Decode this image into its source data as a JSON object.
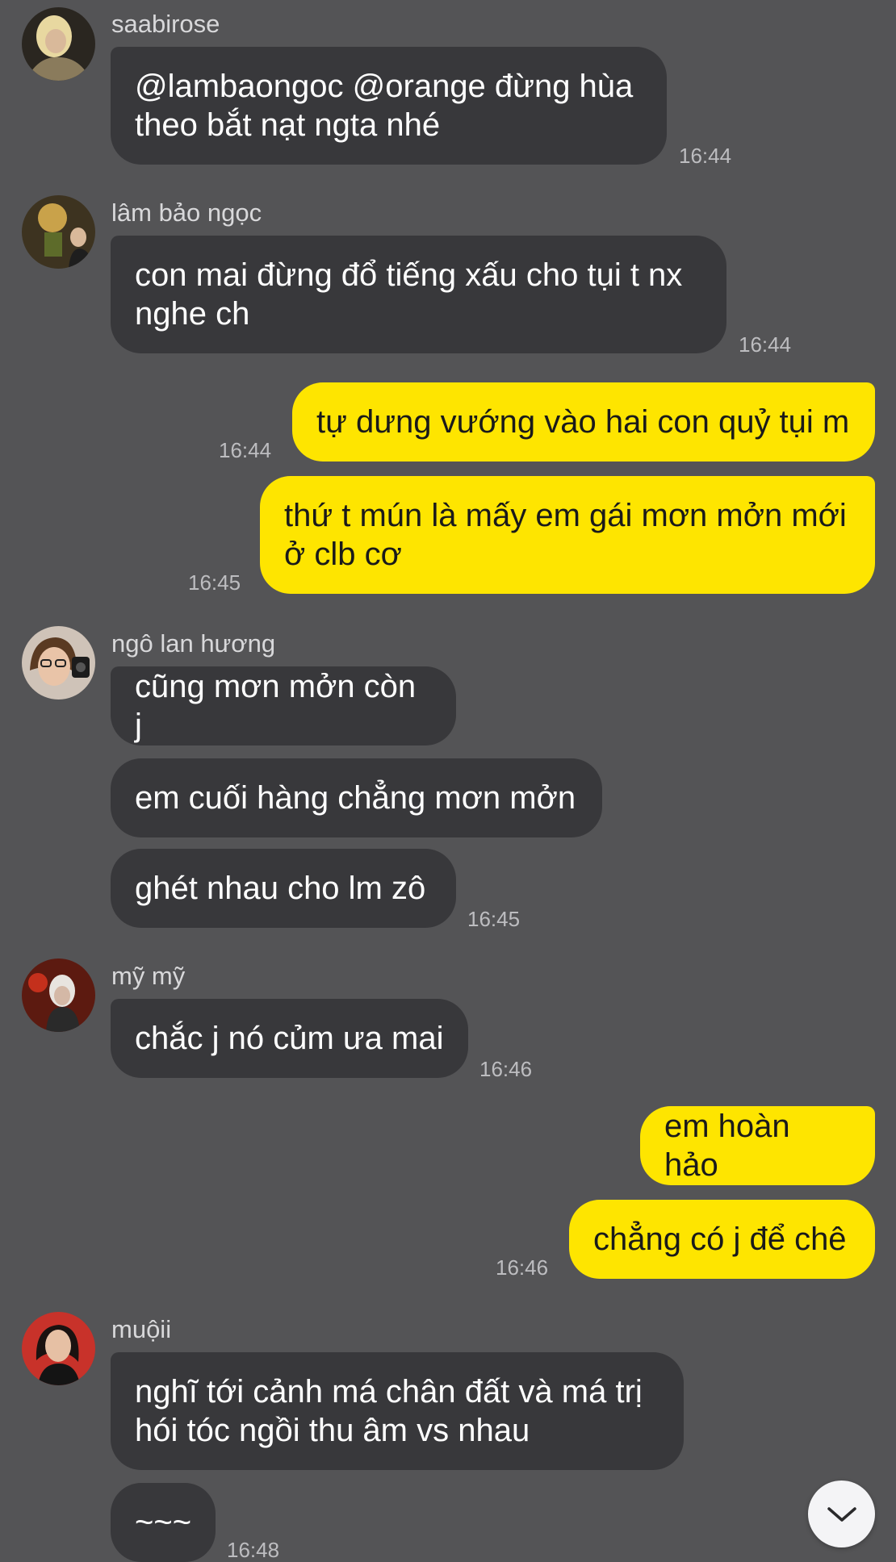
{
  "messages": [
    {
      "sender": "saabirose",
      "text_lines": [
        "@lambaongoc @orange đừng hùa",
        "theo bắt nạt ngta nhé"
      ],
      "time": "16:44"
    },
    {
      "sender": "lâm bảo ngọc",
      "text_lines": [
        "con mai đừng đổ tiếng xấu cho tụi t nx",
        "nghe ch"
      ],
      "time": "16:44"
    },
    {
      "sender": "me",
      "text_lines": [
        "tự dưng vướng vào hai con quỷ tụi m"
      ],
      "time": "16:44"
    },
    {
      "sender": "me",
      "text_lines": [
        "thứ t mún là mấy em gái mơn mởn mới",
        "ở clb cơ"
      ],
      "time": "16:45"
    },
    {
      "sender": "ngô lan hương",
      "text_lines": [
        "cũng mơn mởn còn j"
      ]
    },
    {
      "sender": "ngô lan hương",
      "text_lines": [
        "em cuối hàng chẳng mơn mởn"
      ]
    },
    {
      "sender": "ngô lan hương",
      "text_lines": [
        "ghét nhau cho lm zô"
      ],
      "time": "16:45"
    },
    {
      "sender": "mỹ mỹ",
      "text_lines": [
        "chắc j nó củm ưa mai"
      ],
      "time": "16:46"
    },
    {
      "sender": "me",
      "text_lines": [
        "em hoàn hảo"
      ]
    },
    {
      "sender": "me",
      "text_lines": [
        "chẳng có j để chê"
      ],
      "time": "16:46"
    },
    {
      "sender": "muộii",
      "text_lines": [
        "nghĩ tới cảnh má chân đất và má trị",
        "hói tóc ngồi thu âm vs nhau"
      ]
    },
    {
      "sender": "muộii",
      "text_lines": [
        "~~~"
      ],
      "time": "16:48"
    }
  ],
  "avatars": {
    "saabirose": {
      "icon": "avatar-saabirose",
      "color": "#8a7b5c"
    },
    "lambaongoc": {
      "icon": "avatar-lambaongoc",
      "color": "#6b5a2c"
    },
    "ngolanhuong": {
      "icon": "avatar-ngolanhuong",
      "color": "#c9b6a8"
    },
    "mymy": {
      "icon": "avatar-mymy",
      "color": "#7a2a1a"
    },
    "muoii": {
      "icon": "avatar-muoii",
      "color": "#c23a2a"
    }
  },
  "colors": {
    "background": "#545456",
    "incoming_bubble": "#38383b",
    "outgoing_bubble": "#fee500"
  },
  "scroll_button": {
    "icon": "chevron-down-icon"
  }
}
